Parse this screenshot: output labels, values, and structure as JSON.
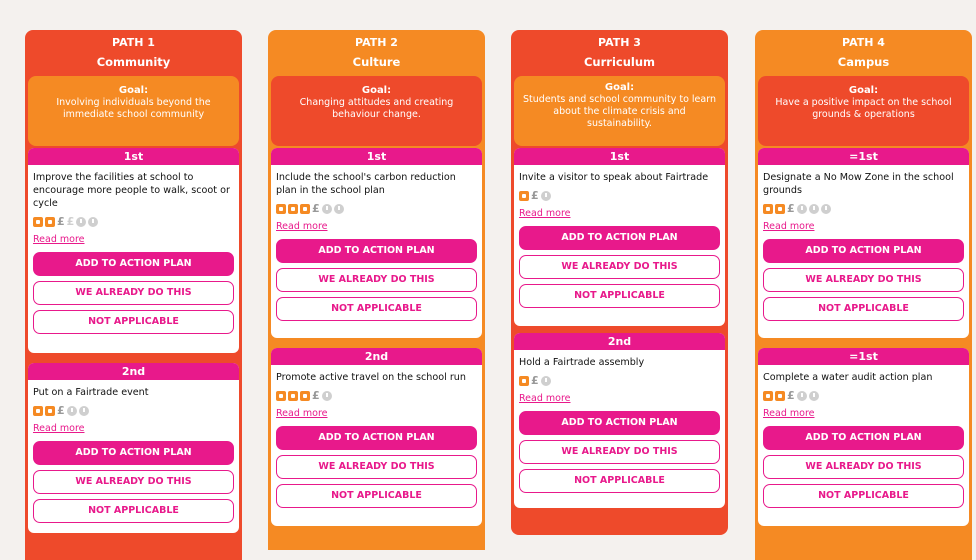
{
  "labels": {
    "read_more": "Read more",
    "add": "ADD TO ACTION PLAN",
    "already": "WE ALREADY DO THIS",
    "na": "NOT APPLICABLE",
    "goal_heading": "Goal:"
  },
  "colors": {
    "red": "#ee4a2b",
    "orange": "#f58a23",
    "pink": "#e8198b"
  },
  "paths": [
    {
      "path_label": "PATH 1",
      "name": "Community",
      "goal": "Involving individuals beyond the immediate school community",
      "actions": [
        {
          "rank": "1st",
          "title": "Improve the facilities at school to encourage more people to walk, scoot or cycle",
          "effort": 2,
          "cost": "££",
          "time": 2
        },
        {
          "rank": "2nd",
          "title": "Put on a Fairtrade event",
          "effort": 2,
          "cost": "£",
          "time": 2
        }
      ]
    },
    {
      "path_label": "PATH 2",
      "name": "Culture",
      "goal": "Changing attitudes and creating behaviour change.",
      "actions": [
        {
          "rank": "1st",
          "title": "Include the school's carbon reduction plan in the school plan",
          "effort": 3,
          "cost": "£",
          "time": 2
        },
        {
          "rank": "2nd",
          "title": "Promote active travel on the school run",
          "effort": 3,
          "cost": "£",
          "time": 1
        }
      ]
    },
    {
      "path_label": "PATH 3",
      "name": "Curriculum",
      "goal": "Students and school community to learn about the climate crisis and sustainability.",
      "actions": [
        {
          "rank": "1st",
          "title": "Invite a visitor to speak about Fairtrade",
          "effort": 1,
          "cost": "£",
          "time": 1
        },
        {
          "rank": "2nd",
          "title": "Hold a Fairtrade assembly",
          "effort": 1,
          "cost": "£",
          "time": 1
        }
      ]
    },
    {
      "path_label": "PATH 4",
      "name": "Campus",
      "goal": "Have a positive impact on the school grounds & operations",
      "actions": [
        {
          "rank": "=1st",
          "title": "Designate a No Mow Zone in the school grounds",
          "effort": 2,
          "cost": "£",
          "time": 3
        },
        {
          "rank": "=1st",
          "title": "Complete a water audit action plan",
          "effort": 2,
          "cost": "£",
          "time": 2
        }
      ]
    }
  ]
}
